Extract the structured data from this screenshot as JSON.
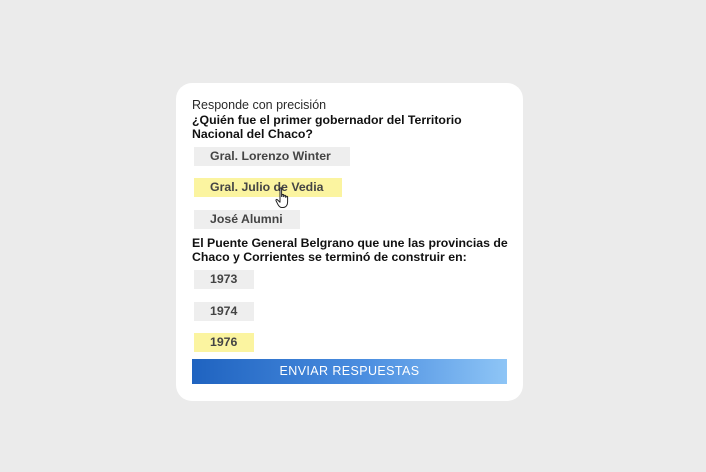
{
  "quiz": {
    "intro": "Responde con precisión",
    "questions": [
      {
        "text": "¿Quién fue el primer gobernador del Territorio Nacional del Chaco?",
        "options": [
          "Gral. Lorenzo Winter",
          "Gral. Julio de Vedia",
          "José Alumni"
        ],
        "selected": "Gral. Julio de Vedia"
      },
      {
        "text": "El Puente General Belgrano que une las provincias de Chaco y Corrientes se terminó de construir en:",
        "options": [
          "1973",
          "1974",
          "1976"
        ],
        "selected": "1976"
      }
    ],
    "submit_label": "ENVIAR RESPUESTAS"
  },
  "colors": {
    "background": "#ebebeb",
    "card": "#ffffff",
    "option_default": "#eeeeee",
    "option_selected": "#fbf4a0",
    "button_gradient_start": "#1f63c0",
    "button_gradient_end": "#8ec5f6"
  },
  "icons": {
    "cursor": "hand-pointer-icon"
  }
}
